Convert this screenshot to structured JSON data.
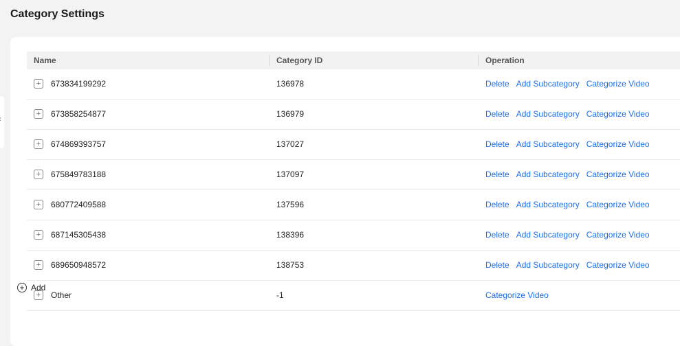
{
  "page": {
    "title": "Category Settings"
  },
  "table": {
    "headers": {
      "name": "Name",
      "category_id": "Category ID",
      "operation": "Operation"
    },
    "rows": [
      {
        "name": "673834199292",
        "category_id": "136978",
        "actions": {
          "delete": "Delete",
          "add_subcategory": "Add Subcategory",
          "categorize_video": "Categorize Video"
        }
      },
      {
        "name": "673858254877",
        "category_id": "136979",
        "actions": {
          "delete": "Delete",
          "add_subcategory": "Add Subcategory",
          "categorize_video": "Categorize Video"
        }
      },
      {
        "name": "674869393757",
        "category_id": "137027",
        "actions": {
          "delete": "Delete",
          "add_subcategory": "Add Subcategory",
          "categorize_video": "Categorize Video"
        }
      },
      {
        "name": "675849783188",
        "category_id": "137097",
        "actions": {
          "delete": "Delete",
          "add_subcategory": "Add Subcategory",
          "categorize_video": "Categorize Video"
        }
      },
      {
        "name": "680772409588",
        "category_id": "137596",
        "actions": {
          "delete": "Delete",
          "add_subcategory": "Add Subcategory",
          "categorize_video": "Categorize Video"
        }
      },
      {
        "name": "687145305438",
        "category_id": "138396",
        "actions": {
          "delete": "Delete",
          "add_subcategory": "Add Subcategory",
          "categorize_video": "Categorize Video"
        }
      },
      {
        "name": "689650948572",
        "category_id": "138753",
        "actions": {
          "delete": "Delete",
          "add_subcategory": "Add Subcategory",
          "categorize_video": "Categorize Video"
        }
      },
      {
        "name": "Other",
        "category_id": "-1",
        "actions": {
          "categorize_video": "Categorize Video"
        }
      }
    ]
  },
  "add_button": {
    "label": "Add"
  },
  "icons": {
    "expand": "plus-square-icon",
    "add": "plus-circle-icon",
    "collapse_sidebar": "chevron-left-icon"
  },
  "colors": {
    "link": "#1a6ee8",
    "header_bg": "#f2f2f2",
    "page_bg": "#f3f3f3"
  }
}
